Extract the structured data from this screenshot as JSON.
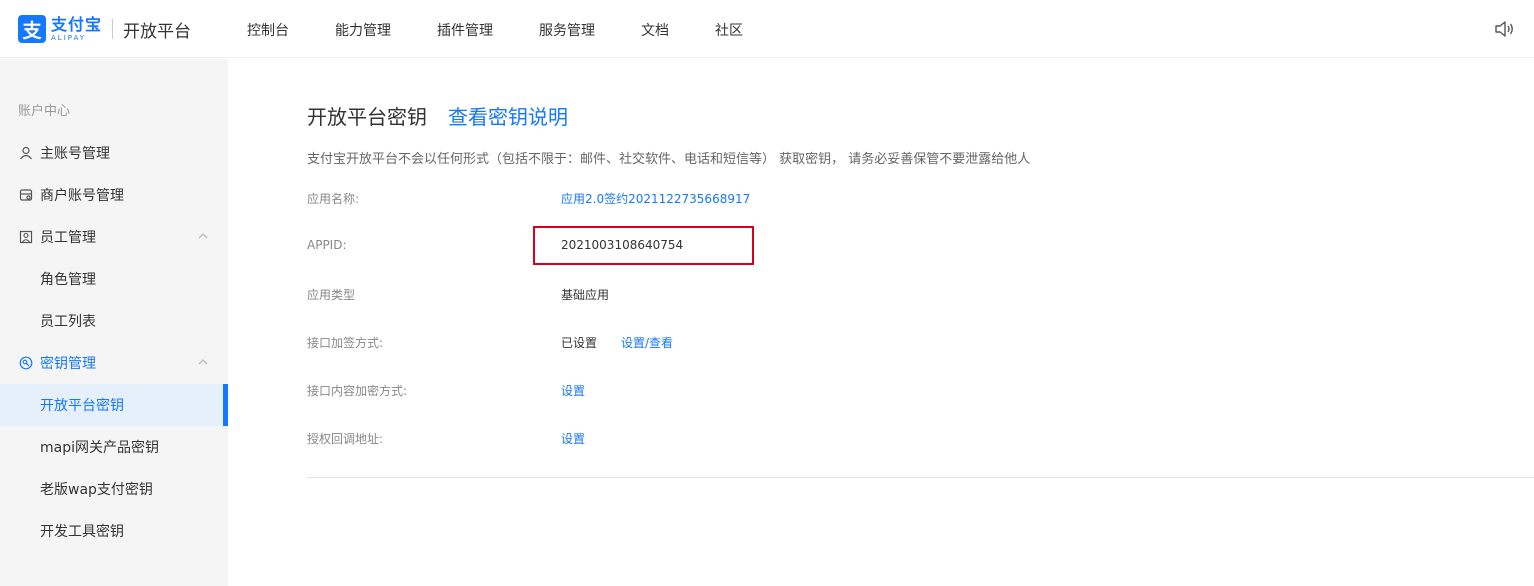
{
  "header": {
    "logo_mark": "支",
    "logo_cn": "支付宝",
    "logo_en": "ALIPAY",
    "platform_title": "开放平台",
    "nav": [
      "控制台",
      "能力管理",
      "插件管理",
      "服务管理",
      "文档",
      "社区"
    ],
    "right_icon": "speaker-icon"
  },
  "sidebar": {
    "group_title": "账户中心",
    "items": [
      {
        "label": "主账号管理",
        "icon": "user-icon"
      },
      {
        "label": "商户账号管理",
        "icon": "merchant-icon"
      },
      {
        "label": "员工管理",
        "icon": "staff-icon"
      },
      {
        "label": "角色管理"
      },
      {
        "label": "员工列表"
      },
      {
        "label": "密钥管理",
        "icon": "key-icon"
      },
      {
        "label": "开放平台密钥"
      },
      {
        "label": "mapi网关产品密钥"
      },
      {
        "label": "老版wap支付密钥"
      },
      {
        "label": "开发工具密钥"
      }
    ]
  },
  "main": {
    "title": "开放平台密钥",
    "title_link": "查看密钥说明",
    "notice": "支付宝开放平台不会以任何形式（包括不限于：邮件、社交软件、电话和短信等） 获取密钥， 请务必妥善保管不要泄露给他人",
    "rows": [
      {
        "label": "应用名称:",
        "value": "应用2.0签约2021122735668917"
      },
      {
        "label": "APPID:",
        "value": "2021003108640754"
      },
      {
        "label": "应用类型",
        "value": "基础应用"
      },
      {
        "label": "接口加签方式:",
        "value": "已设置",
        "link": "设置/查看"
      },
      {
        "label": "接口内容加密方式:",
        "value": "设置"
      },
      {
        "label": "授权回调地址:",
        "value": "设置"
      }
    ]
  },
  "colors": {
    "accent": "#1677ff",
    "highlight": "#d9001b",
    "sidebar_bg": "#f5f5f6"
  }
}
